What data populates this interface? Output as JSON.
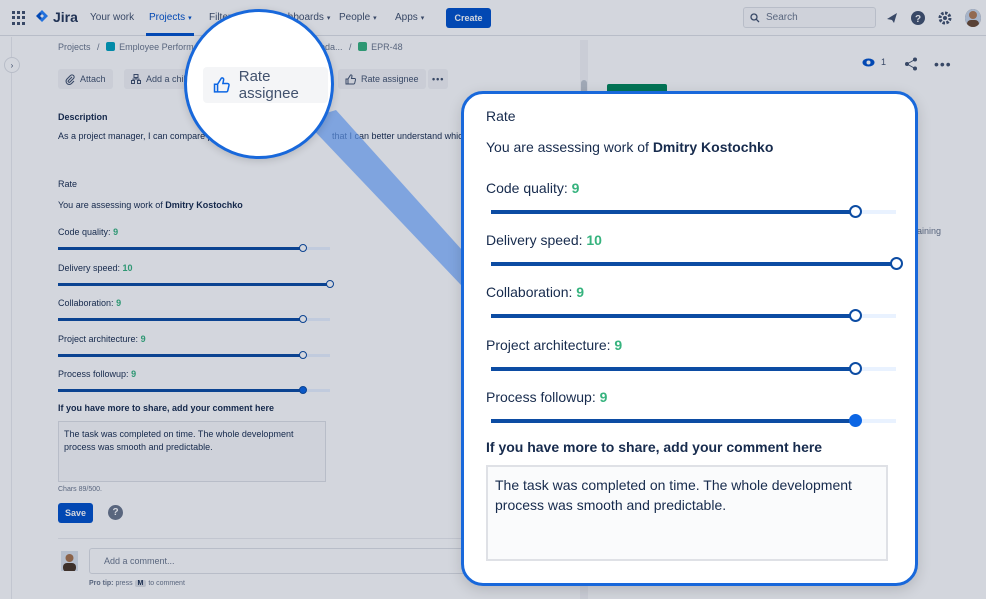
{
  "nav": {
    "product": "Jira",
    "items": [
      "Your work",
      "Projects",
      "Filters",
      "Dashboards",
      "People",
      "Apps"
    ],
    "create_label": "Create",
    "search_placeholder": "Search"
  },
  "breadcrumb": {
    "projects": "Projects",
    "separator": "/",
    "project": "Employee Performa",
    "parent": "oda...",
    "issue": "EPR-48"
  },
  "toolbar": {
    "attach": "Attach",
    "add_child": "Add a child",
    "rate_assignee": "Rate assignee"
  },
  "description": {
    "title": "Description",
    "text_left": "As a project manager, I can compare pe",
    "text_right": "that I can better understand which t"
  },
  "rate": {
    "title": "Rate",
    "assess_prefix": "You are assessing work of",
    "assignee": "Dmitry Kostochko",
    "max": 10,
    "criteria": [
      {
        "label": "Code quality:",
        "value": 9
      },
      {
        "label": "Delivery speed:",
        "value": 10
      },
      {
        "label": "Collaboration:",
        "value": 9
      },
      {
        "label": "Project architecture:",
        "value": 9
      },
      {
        "label": "Process followup:",
        "value": 9
      }
    ],
    "comment_title": "If you have more to share, add your comment here",
    "comment_text": "The task was completed on time. The whole development process was smooth and predictable.",
    "chars": "Chars 89/500.",
    "save_label": "Save"
  },
  "comments": {
    "placeholder": "Add a comment...",
    "protip_label": "Pro tip:",
    "protip_press": "press",
    "protip_key": "M",
    "protip_suffix": "to comment"
  },
  "watchers": {
    "count": "1"
  },
  "side": {
    "remaining": "aining"
  },
  "colors": {
    "accent": "#0052cc",
    "score": "#36b37e",
    "slider": "#0c4ca3",
    "highlight_border": "#1868db"
  }
}
